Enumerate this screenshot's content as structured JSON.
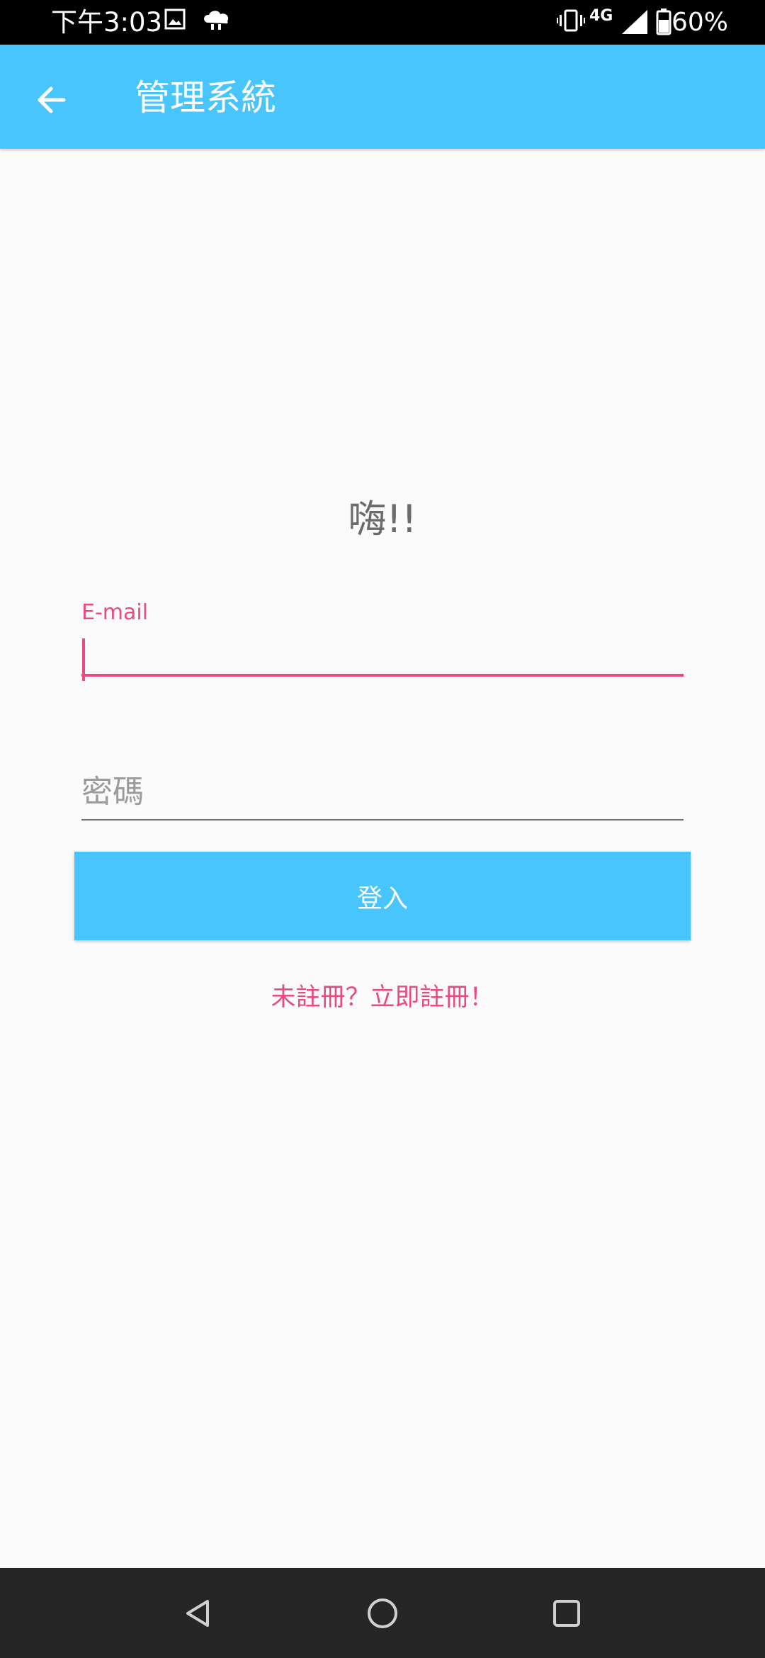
{
  "status_bar": {
    "time": "下午3:03",
    "network": "4G",
    "battery": "60%",
    "icons": [
      "image-icon",
      "cloud-icon",
      "vibrate-icon",
      "signal-icon",
      "battery-icon"
    ]
  },
  "app_bar": {
    "title": "管理系統",
    "back_icon": "arrow-left-icon",
    "background": "#48c5fd"
  },
  "form": {
    "greeting": "嗨!!",
    "email_label": "E-mail",
    "email_value": "",
    "password_placeholder": "密碼",
    "login_label": "登入",
    "register_link": "未註冊？立即註冊！"
  },
  "colors": {
    "accent": "#e84a82",
    "primary": "#48c5fd"
  },
  "nav_bar": {
    "icons": [
      "back-triangle-icon",
      "home-circle-icon",
      "recents-square-icon"
    ]
  }
}
